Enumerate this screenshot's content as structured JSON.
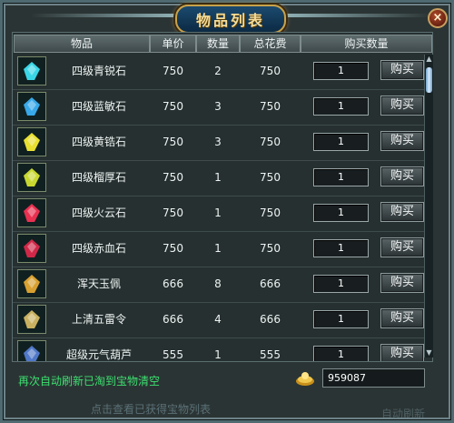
{
  "window": {
    "title": "物品列表",
    "close_label": "×"
  },
  "columns": [
    "物品",
    "单价",
    "数量",
    "总花费",
    "购买数量"
  ],
  "buy_label": "购买",
  "items": [
    {
      "name": "四级青锐石",
      "price": "750",
      "count": "2",
      "total": "750",
      "buy_qty": "1",
      "icon": "cyan-gem-icon",
      "color": "#3ad6e6"
    },
    {
      "name": "四级蓝敏石",
      "price": "750",
      "count": "3",
      "total": "750",
      "buy_qty": "1",
      "icon": "blue-gem-icon",
      "color": "#38a8e8"
    },
    {
      "name": "四级黄锆石",
      "price": "750",
      "count": "3",
      "total": "750",
      "buy_qty": "1",
      "icon": "yellow-gem-icon",
      "color": "#e8e030"
    },
    {
      "name": "四级榴厚石",
      "price": "750",
      "count": "1",
      "total": "750",
      "buy_qty": "1",
      "icon": "green-yellow-gem-icon",
      "color": "#c8d830"
    },
    {
      "name": "四级火云石",
      "price": "750",
      "count": "1",
      "total": "750",
      "buy_qty": "1",
      "icon": "red-gem-icon",
      "color": "#e83050"
    },
    {
      "name": "四级赤血石",
      "price": "750",
      "count": "1",
      "total": "750",
      "buy_qty": "1",
      "icon": "crimson-gem-icon",
      "color": "#d02848"
    },
    {
      "name": "浑天玉佩",
      "price": "666",
      "count": "8",
      "total": "666",
      "buy_qty": "1",
      "icon": "jade-pendant-icon",
      "color": "#d8a030"
    },
    {
      "name": "上清五雷令",
      "price": "666",
      "count": "4",
      "total": "666",
      "buy_qty": "1",
      "icon": "thunder-token-icon",
      "color": "#c8b060"
    },
    {
      "name": "超级元气葫芦",
      "price": "555",
      "count": "1",
      "total": "555",
      "buy_qty": "1",
      "icon": "gourd-icon",
      "color": "#5078c8"
    }
  ],
  "footer": {
    "notice": "再次自动刷新已淘到宝物清空",
    "gold_icon": "gold-ingot-icon",
    "gold_amount": "959087",
    "view_link": "点击查看已获得宝物列表",
    "auto_refresh": "自动刷新"
  }
}
